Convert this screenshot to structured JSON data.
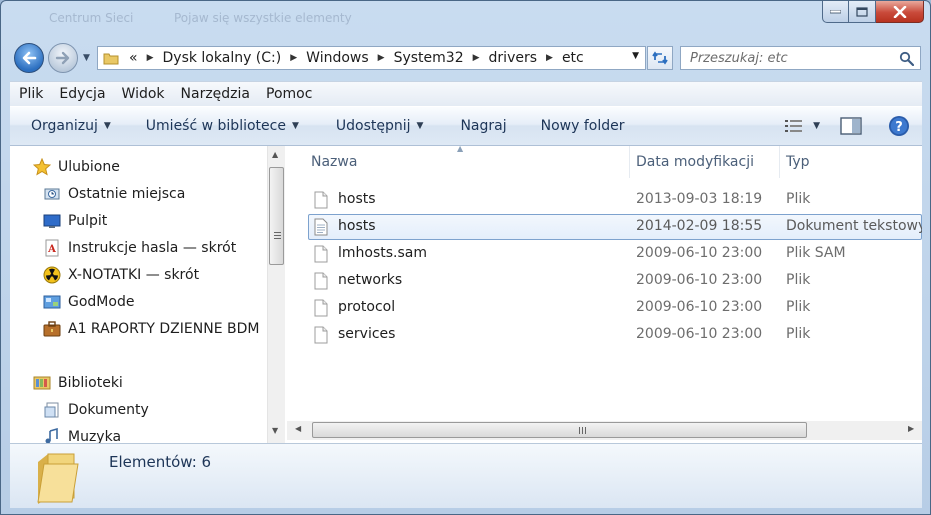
{
  "background_titles": [
    "Centrum Sieci",
    "Pojaw się wszystkie elementy"
  ],
  "window_controls": {
    "minimize": "minimize",
    "maximize": "maximize",
    "close": "close"
  },
  "address": {
    "overflow": "«",
    "breadcrumbs": [
      "Dysk lokalny (C:)",
      "Windows",
      "System32",
      "drivers",
      "etc"
    ]
  },
  "search": {
    "placeholder": "Przeszukaj: etc"
  },
  "menu": [
    "Plik",
    "Edycja",
    "Widok",
    "Narzędzia",
    "Pomoc"
  ],
  "toolbar": {
    "organize": "Organizuj",
    "include_library": "Umieść w bibliotece",
    "share": "Udostępnij",
    "burn": "Nagraj",
    "new_folder": "Nowy folder"
  },
  "nav": {
    "favorites_header": "Ulubione",
    "favorites": [
      {
        "label": "Ostatnie miejsca",
        "icon": "recent-places-icon"
      },
      {
        "label": "Pulpit",
        "icon": "desktop-icon"
      },
      {
        "label": "Instrukcje hasla — skrót",
        "icon": "pdf-shortcut-icon"
      },
      {
        "label": "X-NOTATKI — skrót",
        "icon": "radiation-shortcut-icon"
      },
      {
        "label": "GodMode",
        "icon": "control-panel-icon"
      },
      {
        "label": "A1 RAPORTY  DZIENNE BDM",
        "icon": "briefcase-icon"
      }
    ],
    "libraries_header": "Biblioteki",
    "libraries": [
      {
        "label": "Dokumenty",
        "icon": "documents-icon"
      },
      {
        "label": "Muzyka",
        "icon": "music-icon"
      }
    ]
  },
  "columns": {
    "name": "Nazwa",
    "date": "Data modyfikacji",
    "type": "Typ"
  },
  "files": [
    {
      "name": "hosts",
      "date": "2013-09-03 18:19",
      "type": "Plik",
      "icon": "file-icon",
      "selected": false
    },
    {
      "name": "hosts",
      "date": "2014-02-09 18:55",
      "type": "Dokument tekstowy",
      "icon": "text-file-icon",
      "selected": true
    },
    {
      "name": "lmhosts.sam",
      "date": "2009-06-10 23:00",
      "type": "Plik SAM",
      "icon": "file-icon",
      "selected": false
    },
    {
      "name": "networks",
      "date": "2009-06-10 23:00",
      "type": "Plik",
      "icon": "file-icon",
      "selected": false
    },
    {
      "name": "protocol",
      "date": "2009-06-10 23:00",
      "type": "Plik",
      "icon": "file-icon",
      "selected": false
    },
    {
      "name": "services",
      "date": "2009-06-10 23:00",
      "type": "Plik",
      "icon": "file-icon",
      "selected": false
    }
  ],
  "status": {
    "item_count": "Elementów: 6"
  },
  "colors": {
    "accent": "#2c6fc0",
    "selection_border": "#7da2ce",
    "close_button": "#c94a3a"
  }
}
